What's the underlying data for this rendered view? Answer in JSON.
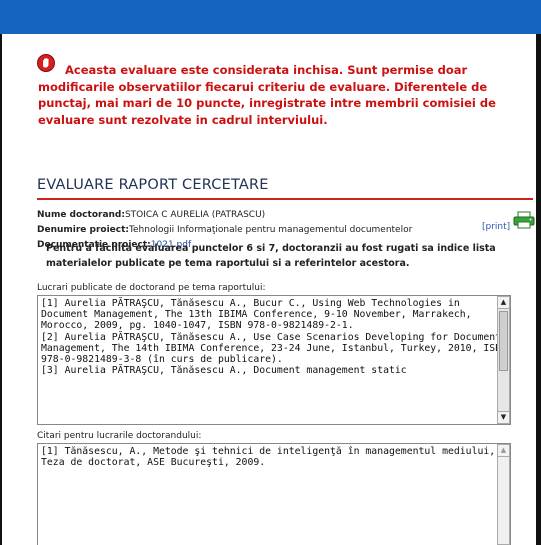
{
  "warning": {
    "text": "Aceasta evaluare este considerata inchisa. Sunt permise doar modificarile observatiilor fiecarui criteriu de evaluare. Diferentele de punctaj, mai mari de 10 puncte, inregistrate intre membrii comisiei de evaluare sunt rezolvate in cadrul interviului."
  },
  "heading": "EVALUARE RAPORT CERCETARE",
  "info": {
    "doctorand_label": "Nume doctorand:",
    "doctorand_value": "STOICA C AURELIA (PATRASCU)",
    "project_label": "Denumire proiect:",
    "project_value": "Tehnologii Informaţionale pentru managementul documentelor",
    "doc_label": "Documentatie proiect:",
    "doc_link": "1021.pdf"
  },
  "print_link": "[print]",
  "note": "Pentru a facilita evaluarea punctelor 6 si 7, doctoranzii au fost rugati sa indice lista materialelor publicate pe tema raportului si a referintelor acestora.",
  "publications": {
    "label": "Lucrari publicate de doctorand pe tema raportului:",
    "content": "[1] Aurelia PĂTRAŞCU, Tănăsescu A., Bucur C., Using Web Technologies in Document Management, The 13th IBIMA Conference, 9-10 November, Marrakech, Morocco, 2009, pg. 1040-1047, ISBN 978-0-9821489-2-1.\n[2] Aurelia PĂTRAŞCU, Tănăsescu A., Use Case Scenarios Developing for Document Management, The 14th IBIMA Conference, 23-24 June, Istanbul, Turkey, 2010, ISBN 978-0-9821489-3-8 (în curs de publicare).\n[3] Aurelia PĂTRAŞCU, Tănăsescu A., Document management static"
  },
  "citations": {
    "label": "Citari pentru lucrarile doctorandului:",
    "content": "[1] Tănăsescu, A., Metode şi tehnici de inteligenţă în managementul mediului, Teza de doctorat, ASE Bucureşti, 2009."
  },
  "colors": {
    "topbar": "#1565c0",
    "warning": "#cc1111",
    "rule": "#cc2222",
    "link": "#1a4a9a"
  }
}
